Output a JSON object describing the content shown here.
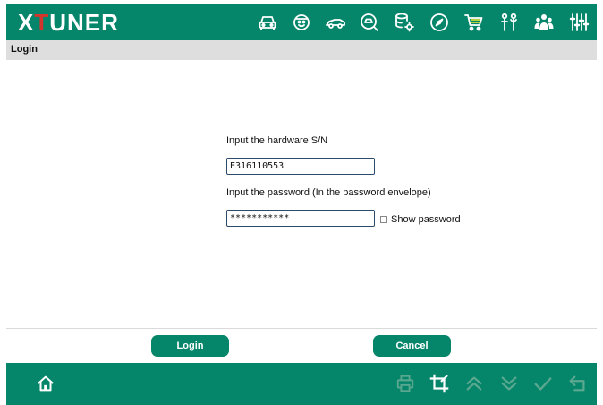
{
  "app": {
    "logo_prefix": "X",
    "logo_t": "T",
    "logo_suffix": "UNER"
  },
  "toolbar": {
    "icons": [
      "car-front-icon",
      "mechanic-icon",
      "sport-car-icon",
      "car-search-icon",
      "database-settings-icon",
      "compass-icon",
      "shopping-cart-icon",
      "user-support-icon",
      "group-icon",
      "sliders-icon"
    ]
  },
  "page": {
    "title": "Login"
  },
  "form": {
    "serial_label": "Input the hardware S/N",
    "serial_value": "E316110553",
    "password_label": "Input the password (In the password envelope)",
    "password_value": "***********",
    "show_password_label": "Show password",
    "show_password_checked": false
  },
  "actions": {
    "login_label": "Login",
    "cancel_label": "Cancel"
  },
  "footer": {
    "left_icons": [
      "home-icon"
    ],
    "right_icons": [
      "print-icon",
      "crop-icon",
      "double-chevron-up-icon",
      "double-chevron-down-icon",
      "checkmark-icon",
      "back-icon"
    ]
  },
  "colors": {
    "brand_green": "#05866b",
    "logo_red": "#d4342c",
    "subbar_gray": "#dedede",
    "footer_disabled_icon": "#5aa88f"
  }
}
